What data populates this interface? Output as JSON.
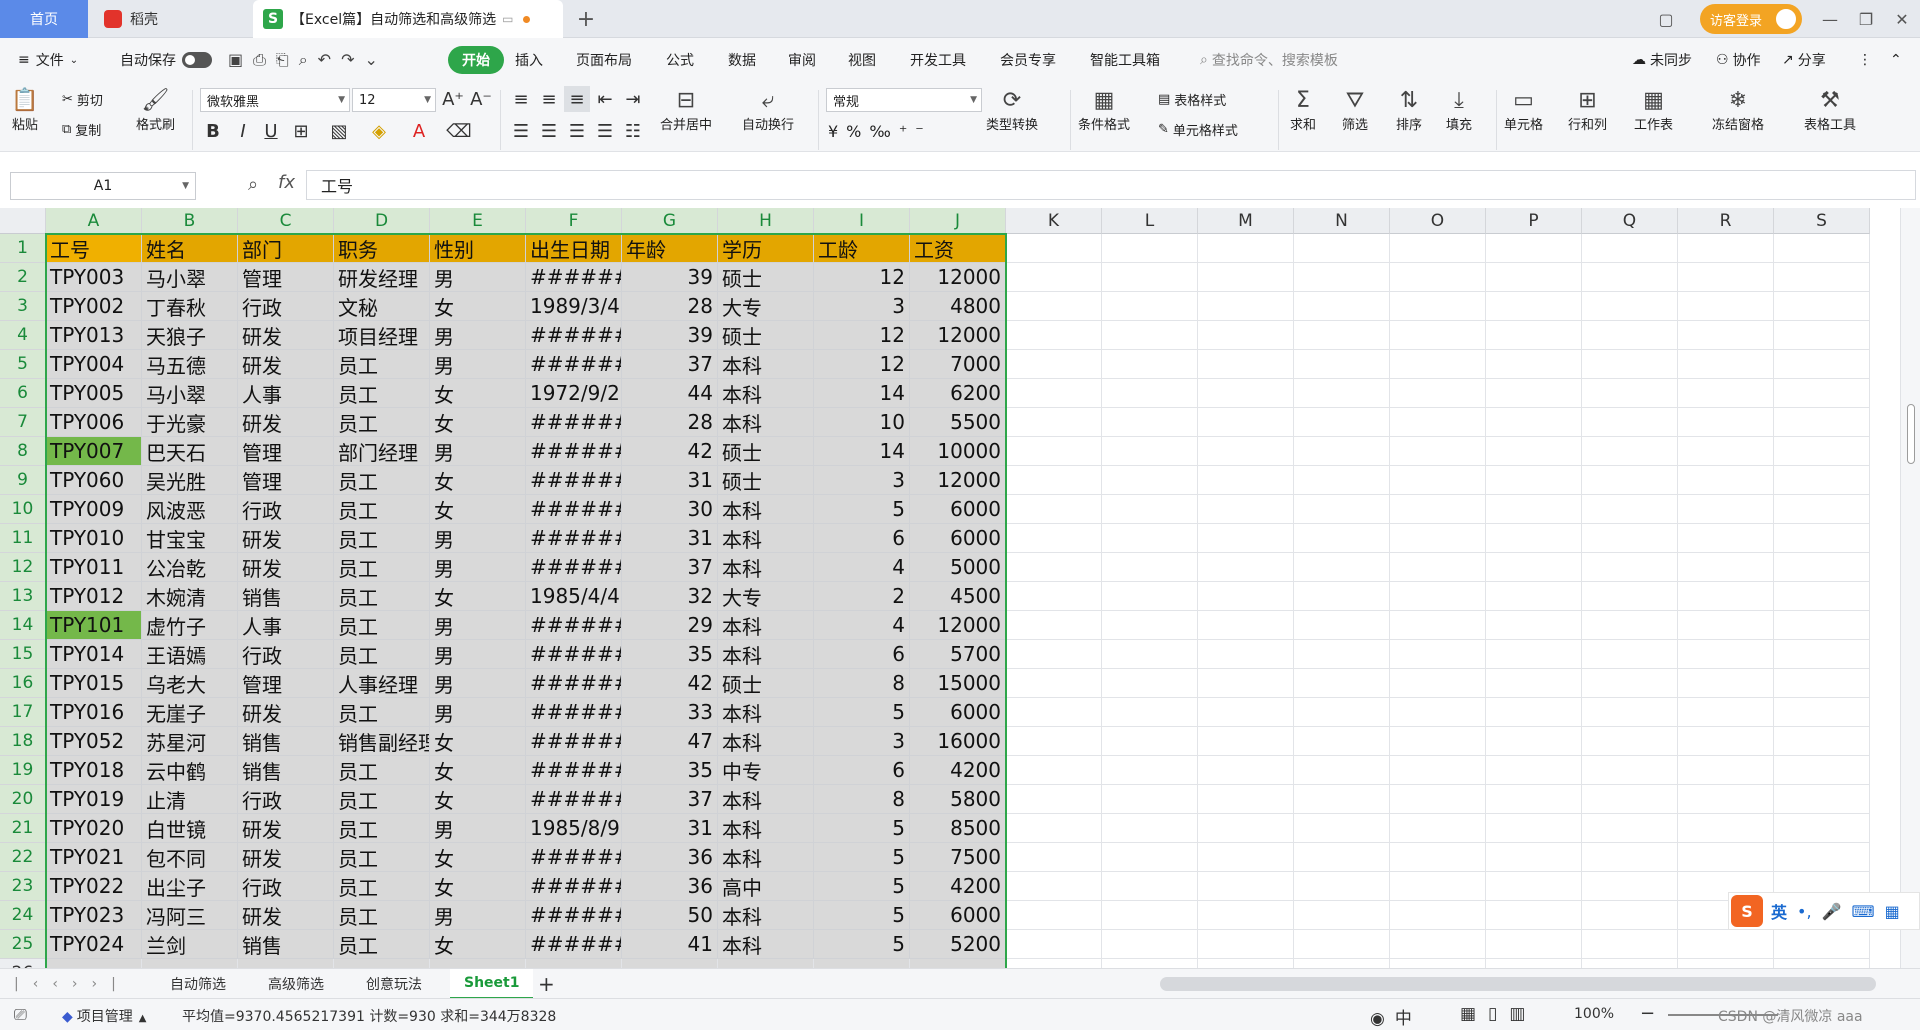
{
  "tabs": {
    "home": "首页",
    "daoke": "稻壳",
    "doc": "【Excel篇】自动筛选和高级筛选",
    "new": "+"
  },
  "visitor_login": "访客登录",
  "menu": {
    "file": "文件",
    "autosave": "自动保存",
    "items": [
      "开始",
      "插入",
      "页面布局",
      "公式",
      "数据",
      "审阅",
      "视图",
      "开发工具",
      "会员专享",
      "智能工具箱"
    ],
    "search_placeholder": "查找命令、搜索模板",
    "unsync": "未同步",
    "collab": "协作",
    "share": "分享"
  },
  "ribbon": {
    "paste": "粘贴",
    "cut": "剪切",
    "copy": "复制",
    "format_painter": "格式刷",
    "font_name": "微软雅黑",
    "font_size": "12",
    "merge": "合并居中",
    "wrap": "自动换行",
    "number_format": "常规",
    "type_convert": "类型转换",
    "cond_format": "条件格式",
    "table_style": "表格样式",
    "cell_style": "单元格样式",
    "sum": "求和",
    "filter": "筛选",
    "sort": "排序",
    "fill": "填充",
    "cell": "单元格",
    "rowcol": "行和列",
    "worksheet": "工作表",
    "freeze": "冻结窗格",
    "tabletools": "表格工具"
  },
  "formula_bar": {
    "namebox": "A1",
    "fx": "fx",
    "content": "工号"
  },
  "columns": [
    "A",
    "B",
    "C",
    "D",
    "E",
    "F",
    "G",
    "H",
    "I",
    "J",
    "K",
    "L",
    "M",
    "N",
    "O",
    "P",
    "Q",
    "R",
    "S"
  ],
  "header_row": [
    "工号",
    "姓名",
    "部门",
    "职务",
    "性别",
    "出生日期",
    "年龄",
    "学历",
    "工龄",
    "工资"
  ],
  "rows": [
    [
      "TPY003",
      "马小翠",
      "管理",
      "研发经理",
      "男",
      "#######",
      "39",
      "硕士",
      "12",
      "12000"
    ],
    [
      "TPY002",
      "丁春秋",
      "行政",
      "文秘",
      "女",
      "1989/3/4",
      "28",
      "大专",
      "3",
      "4800"
    ],
    [
      "TPY013",
      "天狼子",
      "研发",
      "项目经理",
      "男",
      "#######",
      "39",
      "硕士",
      "12",
      "12000"
    ],
    [
      "TPY004",
      "马五德",
      "研发",
      "员工",
      "男",
      "#######",
      "37",
      "本科",
      "12",
      "7000"
    ],
    [
      "TPY005",
      "马小翠",
      "人事",
      "员工",
      "女",
      "1972/9/2",
      "44",
      "本科",
      "14",
      "6200"
    ],
    [
      "TPY006",
      "于光豪",
      "研发",
      "员工",
      "女",
      "#######",
      "28",
      "本科",
      "10",
      "5500"
    ],
    [
      "TPY007",
      "巴天石",
      "管理",
      "部门经理",
      "男",
      "#######",
      "42",
      "硕士",
      "14",
      "10000"
    ],
    [
      "TPY060",
      "吴光胜",
      "管理",
      "员工",
      "女",
      "#######",
      "31",
      "硕士",
      "3",
      "12000"
    ],
    [
      "TPY009",
      "风波恶",
      "行政",
      "员工",
      "女",
      "#######",
      "30",
      "本科",
      "5",
      "6000"
    ],
    [
      "TPY010",
      "甘宝宝",
      "研发",
      "员工",
      "男",
      "#######",
      "31",
      "本科",
      "6",
      "6000"
    ],
    [
      "TPY011",
      "公冶乾",
      "研发",
      "员工",
      "男",
      "#######",
      "37",
      "本科",
      "4",
      "5000"
    ],
    [
      "TPY012",
      "木婉清",
      "销售",
      "员工",
      "女",
      "1985/4/4",
      "32",
      "大专",
      "2",
      "4500"
    ],
    [
      "TPY101",
      "虚竹子",
      "人事",
      "员工",
      "男",
      "#######",
      "29",
      "本科",
      "4",
      "12000"
    ],
    [
      "TPY014",
      "王语嫣",
      "行政",
      "员工",
      "男",
      "#######",
      "35",
      "本科",
      "6",
      "5700"
    ],
    [
      "TPY015",
      "乌老大",
      "管理",
      "人事经理",
      "男",
      "#######",
      "42",
      "硕士",
      "8",
      "15000"
    ],
    [
      "TPY016",
      "无崖子",
      "研发",
      "员工",
      "男",
      "#######",
      "33",
      "本科",
      "5",
      "6000"
    ],
    [
      "TPY052",
      "苏星河",
      "销售",
      "销售副经理",
      "女",
      "#######",
      "47",
      "本科",
      "3",
      "16000"
    ],
    [
      "TPY018",
      "云中鹤",
      "销售",
      "员工",
      "女",
      "#######",
      "35",
      "中专",
      "6",
      "4200"
    ],
    [
      "TPY019",
      "止清",
      "行政",
      "员工",
      "女",
      "#######",
      "37",
      "本科",
      "8",
      "5800"
    ],
    [
      "TPY020",
      "白世镜",
      "研发",
      "员工",
      "男",
      "1985/8/9",
      "31",
      "本科",
      "5",
      "8500"
    ],
    [
      "TPY021",
      "包不同",
      "研发",
      "员工",
      "女",
      "#######",
      "36",
      "本科",
      "5",
      "7500"
    ],
    [
      "TPY022",
      "出尘子",
      "行政",
      "员工",
      "女",
      "#######",
      "36",
      "高中",
      "5",
      "4200"
    ],
    [
      "TPY023",
      "冯阿三",
      "研发",
      "员工",
      "男",
      "#######",
      "50",
      "本科",
      "5",
      "6000"
    ],
    [
      "TPY024",
      "兰剑",
      "销售",
      "员工",
      "女",
      "#######",
      "41",
      "本科",
      "5",
      "5200"
    ]
  ],
  "highlight_rows": [
    7,
    13
  ],
  "sheets": [
    "自动筛选",
    "高级筛选",
    "创意玩法",
    "Sheet1"
  ],
  "active_sheet": "Sheet1",
  "status": {
    "project": "项目管理",
    "stats": "平均值=9370.4565217391  计数=930  求和=344万8328",
    "zoom": "100%",
    "watermark": "CSDN @清风微凉 aaa"
  },
  "ime": {
    "lang": "英"
  },
  "colors": {
    "header_fill": "#e3a600",
    "selection": "#2ea64a",
    "highlight": "#74b84a",
    "range_fill": "#d9d9d9"
  }
}
